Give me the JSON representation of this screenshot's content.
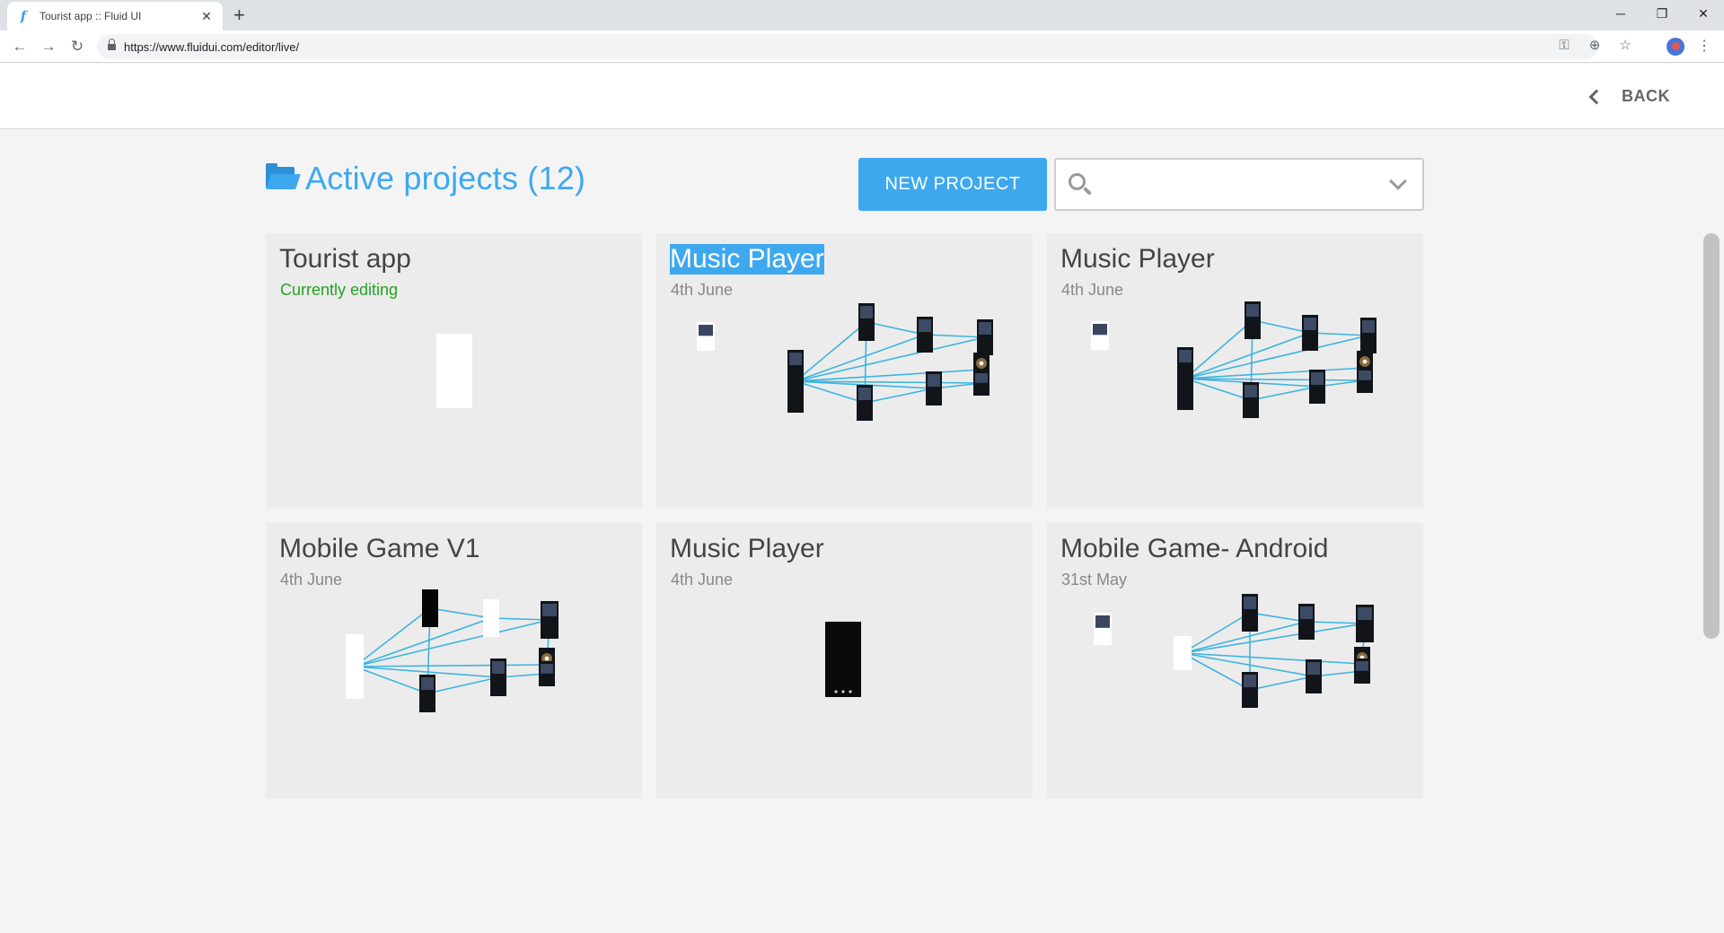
{
  "browser": {
    "tab_title": "Tourist app :: Fluid UI",
    "favicon_letter": "f",
    "tab_close": "✕",
    "new_tab": "+",
    "url": "https://www.fluidui.com/editor/live/",
    "window_controls": {
      "minimize": "─",
      "maximize": "❐",
      "close": "✕"
    },
    "nav": {
      "back": "←",
      "forward": "→",
      "reload": "↻"
    },
    "omni_icons": {
      "key": "⚿",
      "zoom": "⊕",
      "star": "☆"
    },
    "menu": "⋮"
  },
  "header": {
    "back_label": "BACK"
  },
  "main": {
    "title": "Active projects (12)",
    "new_project_label": "NEW PROJECT",
    "search": {
      "value": "",
      "placeholder": ""
    }
  },
  "projects": [
    {
      "title": "Tourist app",
      "subtitle": "Currently editing",
      "thumbnail": "single-blank-screen"
    },
    {
      "title": "Music Player",
      "subtitle": "4th June",
      "thumbnail": "flow-diagram",
      "selected": true
    },
    {
      "title": "Music Player",
      "subtitle": "4th June",
      "thumbnail": "flow-diagram"
    },
    {
      "title": "Mobile Game V1",
      "subtitle": "4th June",
      "thumbnail": "flow-diagram"
    },
    {
      "title": "Music Player",
      "subtitle": "4th June",
      "thumbnail": "single-dark-screen"
    },
    {
      "title": "Mobile Game- Android",
      "subtitle": "31st May",
      "thumbnail": "flow-diagram"
    }
  ],
  "colors": {
    "accent": "#3ea8ef",
    "editing_status": "#22a322",
    "connector_lines": "#3cb4e0",
    "card_background": "#ececec"
  }
}
